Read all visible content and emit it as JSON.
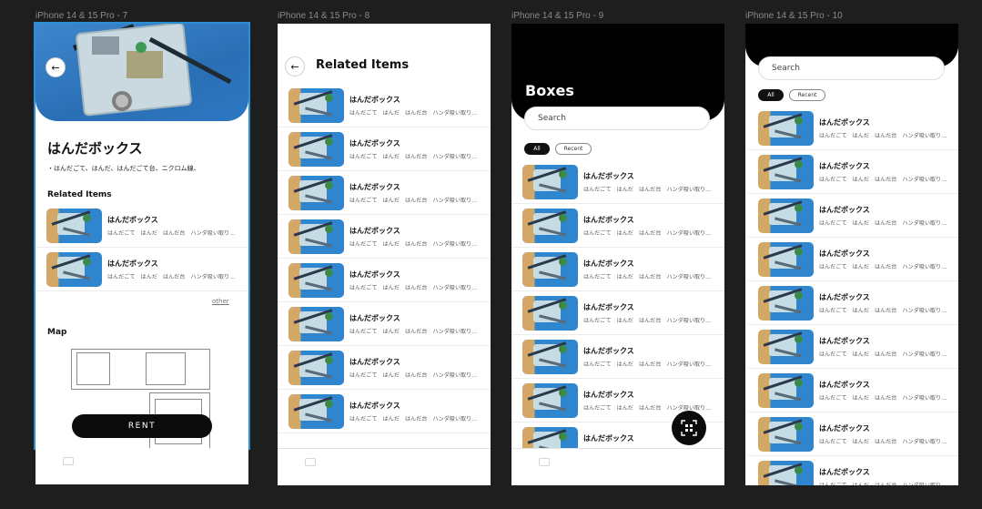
{
  "frames": [
    {
      "title": "iPhone 14 & 15 Pro - 7"
    },
    {
      "title": "iPhone 14 & 15 Pro - 8"
    },
    {
      "title": "iPhone 14 & 15 Pro - 9"
    },
    {
      "title": "iPhone 14 & 15 Pro - 10"
    }
  ],
  "item": {
    "name": "はんだボックス",
    "tags": "はんだごて　はんだ　はんだ台　ハンダ吸い取り..."
  },
  "detail": {
    "title": "はんだボックス",
    "description": "・はんだごて、はんだ、はんだごて台、ニクロム線、",
    "related_heading": "Related Items",
    "other_link": "other",
    "map_heading": "Map",
    "rent_button": "RENT"
  },
  "related": {
    "title": "Related Items"
  },
  "boxes": {
    "title": "Boxes",
    "search_placeholder": "Search",
    "filters": {
      "all": "All",
      "recent": "Recent"
    }
  },
  "colors": {
    "accent": "#000000",
    "selection": "#2b8fd6",
    "canvas": "#1e1e1e"
  },
  "icons": [
    "back-arrow-icon",
    "qr-scan-icon",
    "camera-icon"
  ]
}
